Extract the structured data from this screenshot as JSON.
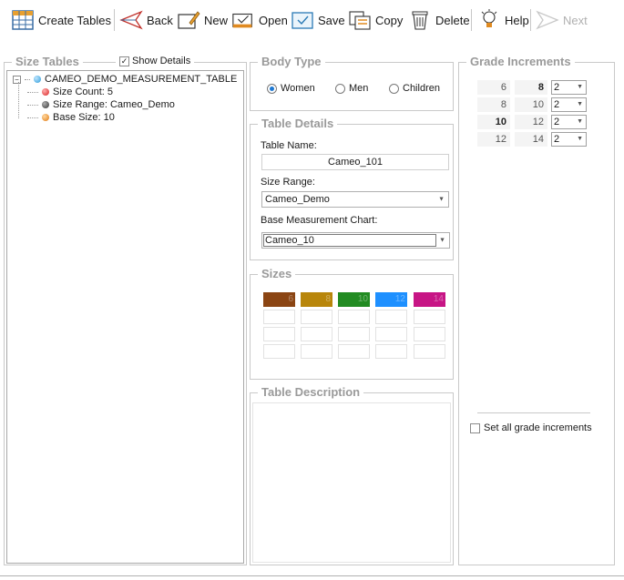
{
  "toolbar": {
    "create_tables": "Create Tables",
    "back": "Back",
    "new": "New",
    "open": "Open",
    "save": "Save",
    "copy": "Copy",
    "delete": "Delete",
    "help": "Help",
    "next": "Next"
  },
  "size_tables": {
    "title": "Size Tables",
    "show_details_label": "Show Details",
    "show_details_checked": true,
    "tree": {
      "root": "CAMEO_DEMO_MEASUREMENT_TABLE",
      "size_count": "Size Count: 5",
      "size_range": "Size Range: Cameo_Demo",
      "base_size": "Base Size: 10"
    }
  },
  "body_type": {
    "title": "Body Type",
    "options": [
      "Women",
      "Men",
      "Children"
    ],
    "selected": "Women"
  },
  "table_details": {
    "title": "Table Details",
    "table_name_label": "Table Name:",
    "table_name_value": "Cameo_101",
    "size_range_label": "Size Range:",
    "size_range_value": "Cameo_Demo",
    "base_chart_label": "Base Measurement Chart:",
    "base_chart_value": "Cameo_10"
  },
  "sizes": {
    "title": "Sizes",
    "swatches": [
      {
        "label": "6",
        "color": "#8b4513"
      },
      {
        "label": "8",
        "color": "#b8860b"
      },
      {
        "label": "10",
        "color": "#228b22"
      },
      {
        "label": "12",
        "color": "#1e90ff"
      },
      {
        "label": "14",
        "color": "#c71585"
      }
    ]
  },
  "table_description": {
    "title": "Table Description"
  },
  "grade_increments": {
    "title": "Grade Increments",
    "rows": [
      {
        "from": "6",
        "to": "8",
        "inc": "2"
      },
      {
        "from": "8",
        "to": "10",
        "inc": "2"
      },
      {
        "from": "10",
        "to": "12",
        "inc": "2"
      },
      {
        "from": "12",
        "to": "14",
        "inc": "2"
      }
    ],
    "set_all_label": "Set all grade increments"
  }
}
